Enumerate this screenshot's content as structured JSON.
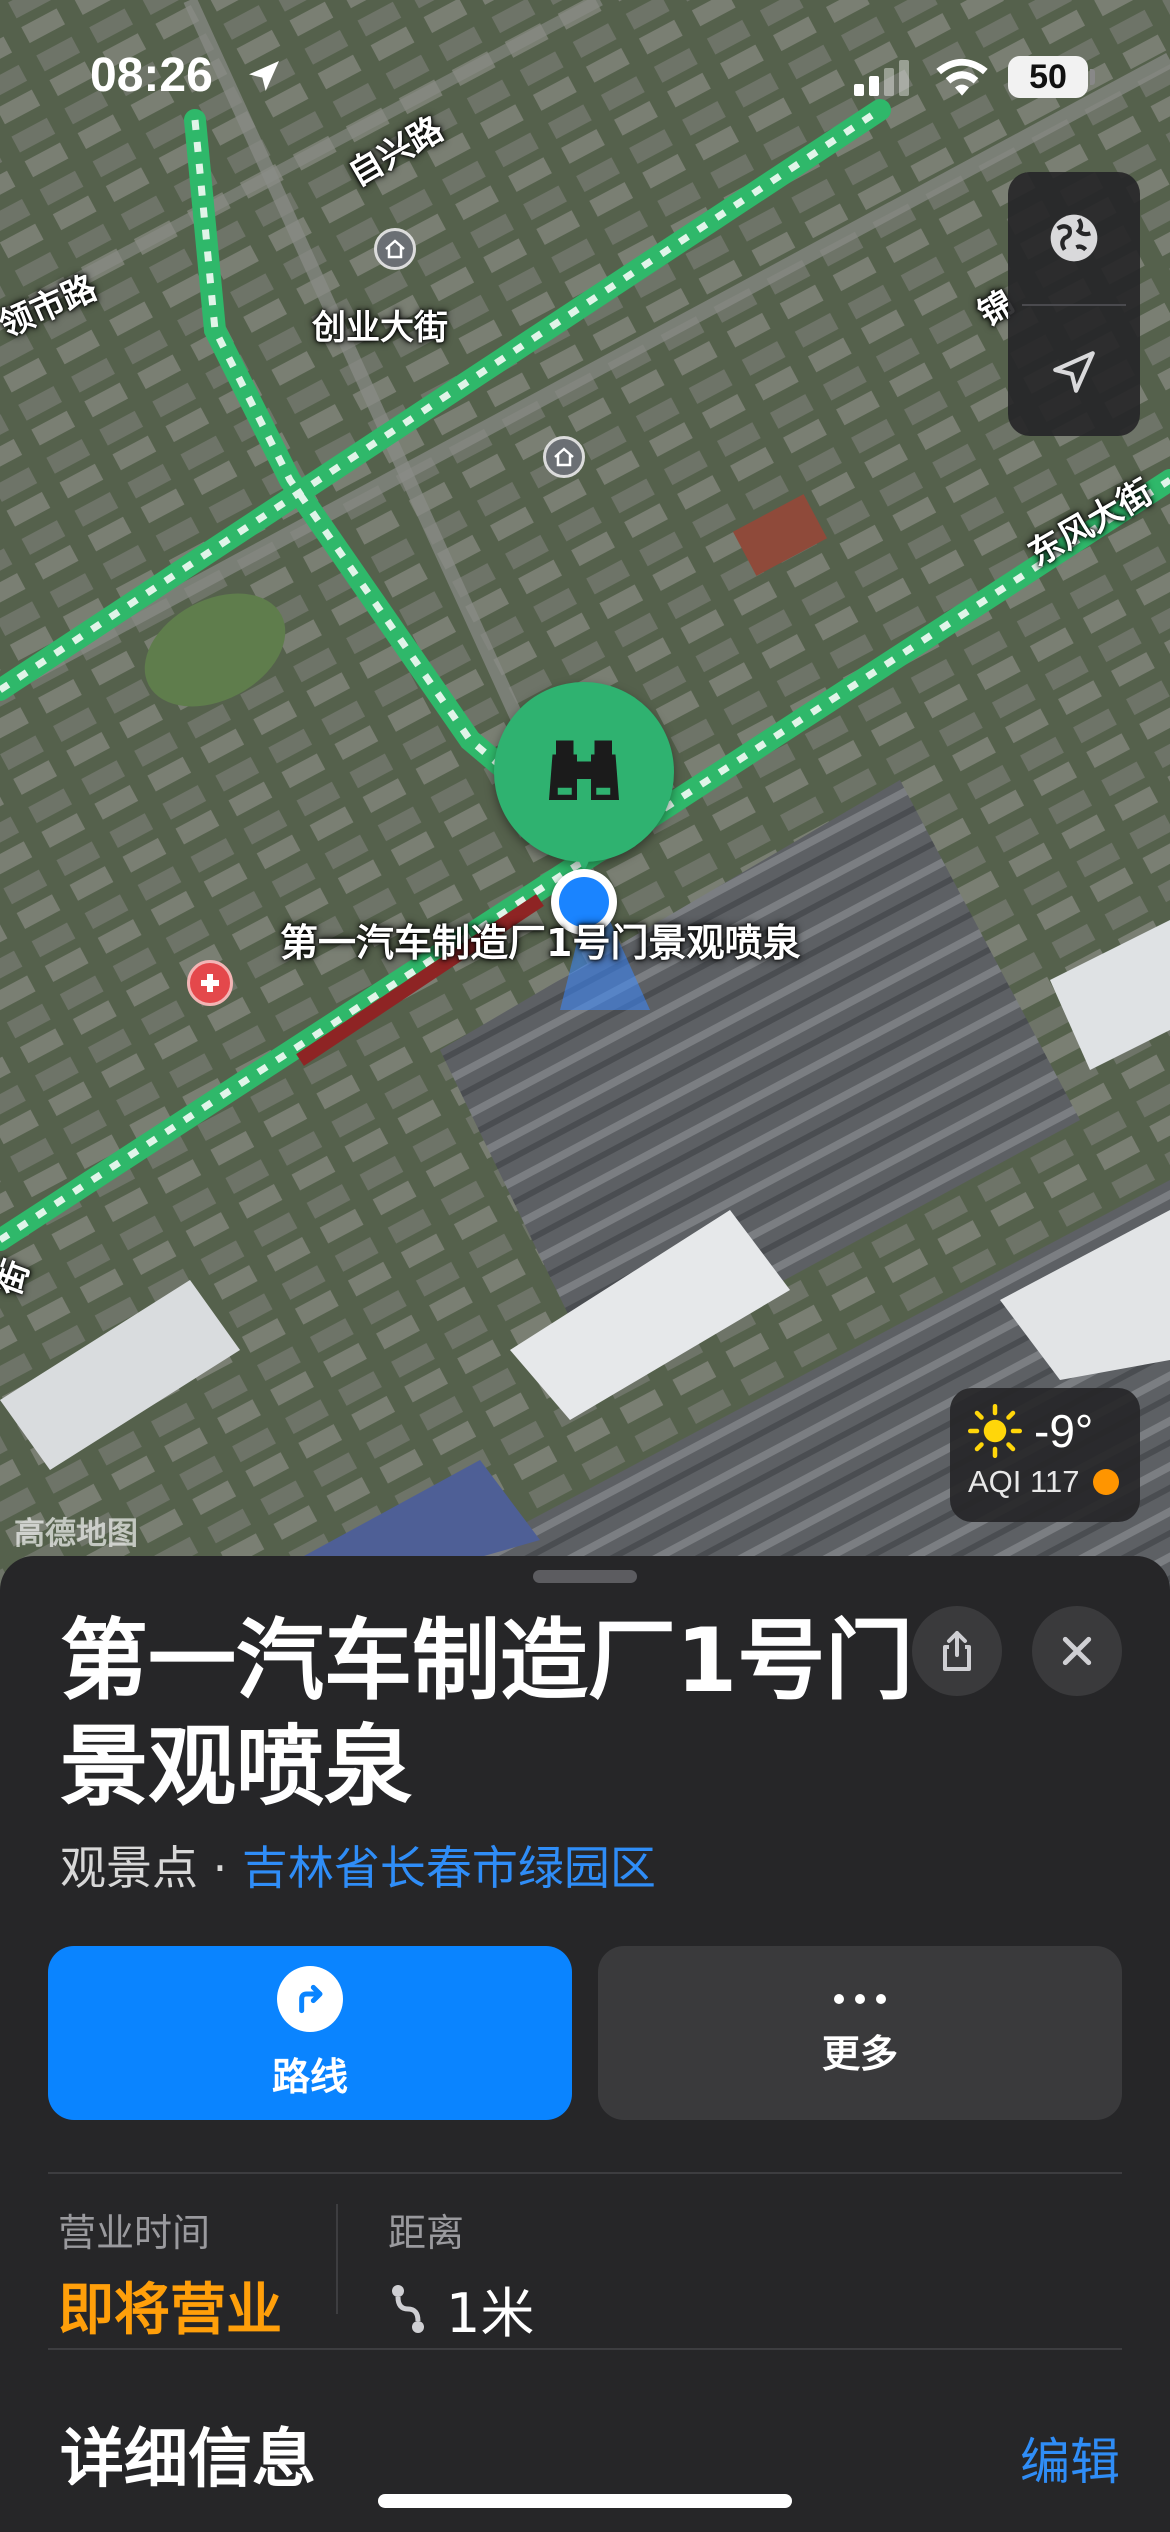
{
  "status_bar": {
    "time": "08:26",
    "battery": "50"
  },
  "map": {
    "street_labels": {
      "zixing": "自兴路",
      "lingxiu": "领市路",
      "chuangye": "创业大街",
      "dongfeng": "东风大街",
      "jin_partial": "锦",
      "jie_partial": "街"
    },
    "place_label": "第一汽车制造厂1号门景观喷泉",
    "weather": {
      "temperature": "-9°",
      "aqi": "AQI 117",
      "aqi_color": "#ff9500"
    },
    "attribution": "高德地图",
    "pin_color": "#2fb270",
    "pin_icon": "binoculars-icon"
  },
  "sheet": {
    "title": "第一汽车制造厂1号门景观喷泉",
    "category": "观景点",
    "separator": "·",
    "location": "吉林省长春市绿园区",
    "actions": {
      "route_label": "路线",
      "more_label": "更多"
    },
    "hours_label": "营业时间",
    "hours_value": "即将营业",
    "distance_label": "距离",
    "distance_value": "1米",
    "details_title": "详细信息",
    "edit_label": "编辑",
    "accent_color": "#0a84ff",
    "hours_color": "#ff9f0a"
  }
}
